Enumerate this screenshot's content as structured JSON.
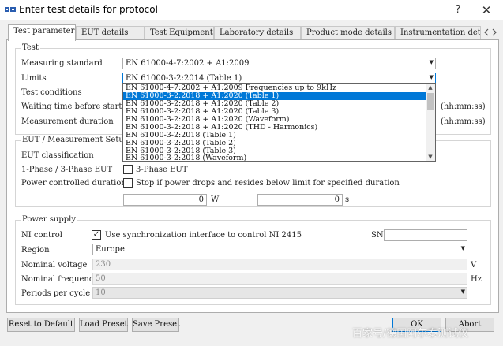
{
  "window": {
    "title": "Enter test details for protocol",
    "help_symbol": "?",
    "close_symbol": "✕"
  },
  "tabs": [
    {
      "label": "Test parameters"
    },
    {
      "label": "EUT details"
    },
    {
      "label": "Test Equipment"
    },
    {
      "label": "Laboratory details"
    },
    {
      "label": "Product mode details"
    },
    {
      "label": "Instrumentation det"
    }
  ],
  "test": {
    "group_title": "Test",
    "measuring_standard": {
      "label": "Measuring standard",
      "value": "EN 61000-4-7:2002 + A1:2009"
    },
    "limits": {
      "label": "Limits",
      "value": "EN 61000-3-2:2014 (Table 1)",
      "options": [
        "EN 61000-4-7:2002 + A1:2009 Frequencies up to 9kHz",
        "EN 61000-3-2:2018 + A1:2020 (Table 1)",
        "EN 61000-3-2:2018 + A1:2020 (Table 2)",
        "EN 61000-3-2:2018 + A1:2020 (Table 3)",
        "EN 61000-3-2:2018 + A1:2020 (Waveform)",
        "EN 61000-3-2:2018 + A1:2020 (THD - Harmonics)",
        "EN 61000-3-2:2018 (Table 1)",
        "EN 61000-3-2:2018 (Table 2)",
        "EN 61000-3-2:2018 (Table 3)",
        "EN 61000-3-2:2018 (Waveform)"
      ]
    },
    "test_conditions_label": "Test conditions",
    "waiting_time": {
      "label": "Waiting time before start",
      "unit": "(hh:mm:ss)"
    },
    "measurement_duration": {
      "label": "Measurement duration",
      "unit": "(hh:mm:ss)"
    }
  },
  "eut": {
    "group_title": "EUT / Measurement Setup",
    "classification_label": "EUT classification",
    "phase": {
      "label": "1-Phase / 3-Phase EUT",
      "checkbox_label": "3-Phase EUT"
    },
    "power_controlled": {
      "label": "Power controlled duration",
      "checkbox_label": "Stop if power drops and resides below limit for specified duration"
    },
    "power_value": "0",
    "power_unit": "W",
    "time_value": "0",
    "time_unit": "s"
  },
  "power_supply": {
    "group_title": "Power supply",
    "ni_control": {
      "label": "NI control",
      "checkbox_label": "Use synchronization interface to control NI 2415",
      "check_mark": "✓"
    },
    "sn_label": "SN",
    "region": {
      "label": "Region",
      "value": "Europe"
    },
    "nominal_voltage": {
      "label": "Nominal voltage",
      "value": "230",
      "unit": "V"
    },
    "nominal_frequency": {
      "label": "Nominal frequency",
      "value": "50",
      "unit": "Hz"
    },
    "periods_per_cycle": {
      "label": "Periods per cycle",
      "value": "10"
    }
  },
  "buttons": {
    "reset": "Reset to Default",
    "load": "Load Preset",
    "save": "Save Preset",
    "ok": "OK",
    "abort": "Abort"
  },
  "watermark_text": "百家号/德国阿尔泰测试仪",
  "colors": {
    "accent": "#0078d7"
  }
}
